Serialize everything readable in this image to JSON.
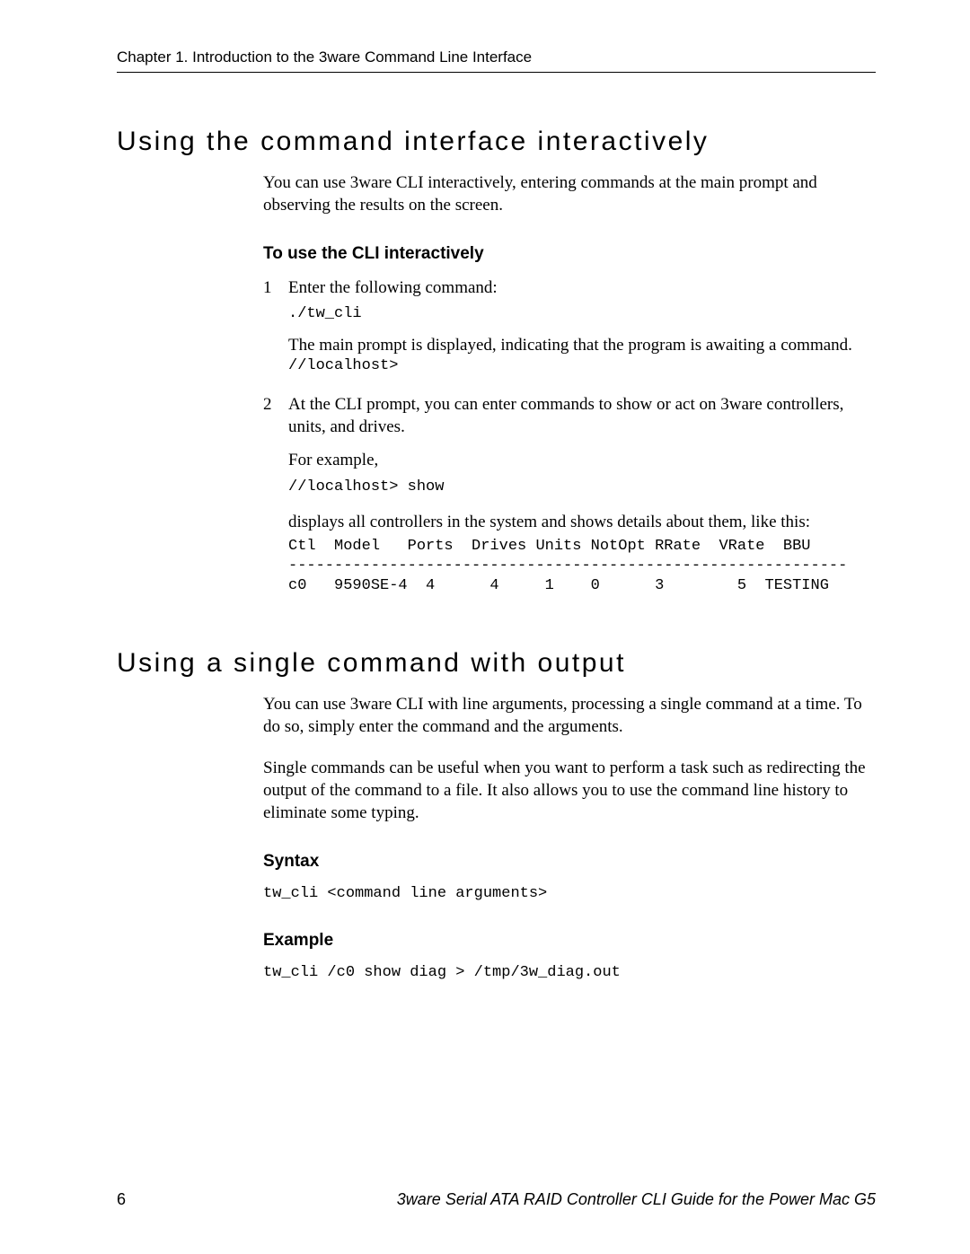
{
  "header": {
    "chapter_line": "Chapter 1. Introduction to the 3ware Command Line Interface"
  },
  "sections": {
    "interactive": {
      "heading": "Using the command interface interactively",
      "intro": "You can use 3ware CLI interactively, entering commands at the main prompt and observing the results on the screen.",
      "sub_heading": "To use the CLI interactively",
      "step1": {
        "num": "1",
        "text": "Enter the following command:",
        "code1": "./tw_cli",
        "para2": "The main prompt is displayed, indicating that the program is awaiting a command.",
        "code2": "//localhost>"
      },
      "step2": {
        "num": "2",
        "text": "At the CLI prompt, you can enter commands to show or act on 3ware controllers, units, and drives.",
        "para2": "For example,",
        "code1": "//localhost> show",
        "para3": "displays all controllers in the system and shows details about them, like this:",
        "table": "Ctl  Model   Ports  Drives Units NotOpt RRate  VRate  BBU\n-------------------------------------------------------------\nc0   9590SE-4  4      4     1    0      3        5  TESTING"
      }
    },
    "single": {
      "heading": "Using a single command with output",
      "intro": "You can use 3ware CLI with line arguments, processing a single command at a time. To do so, simply enter the command and the arguments.",
      "para2": "Single commands can be useful when you want to perform a task such as redirecting the output of the command to a file. It also allows you to use the command line history to eliminate some typing.",
      "syntax_heading": "Syntax",
      "syntax_code": "tw_cli <command line arguments>",
      "example_heading": "Example",
      "example_code": "tw_cli /c0 show diag > /tmp/3w_diag.out"
    }
  },
  "footer": {
    "page_number": "6",
    "book_title": "3ware Serial ATA RAID Controller CLI Guide for the Power Mac G5"
  },
  "chart_data": {
    "type": "table",
    "title": "Controllers listing",
    "columns": [
      "Ctl",
      "Model",
      "Ports",
      "Drives",
      "Units",
      "NotOpt",
      "RRate",
      "VRate",
      "BBU"
    ],
    "rows": [
      [
        "c0",
        "9590SE-4",
        4,
        4,
        1,
        0,
        3,
        5,
        "TESTING"
      ]
    ]
  }
}
